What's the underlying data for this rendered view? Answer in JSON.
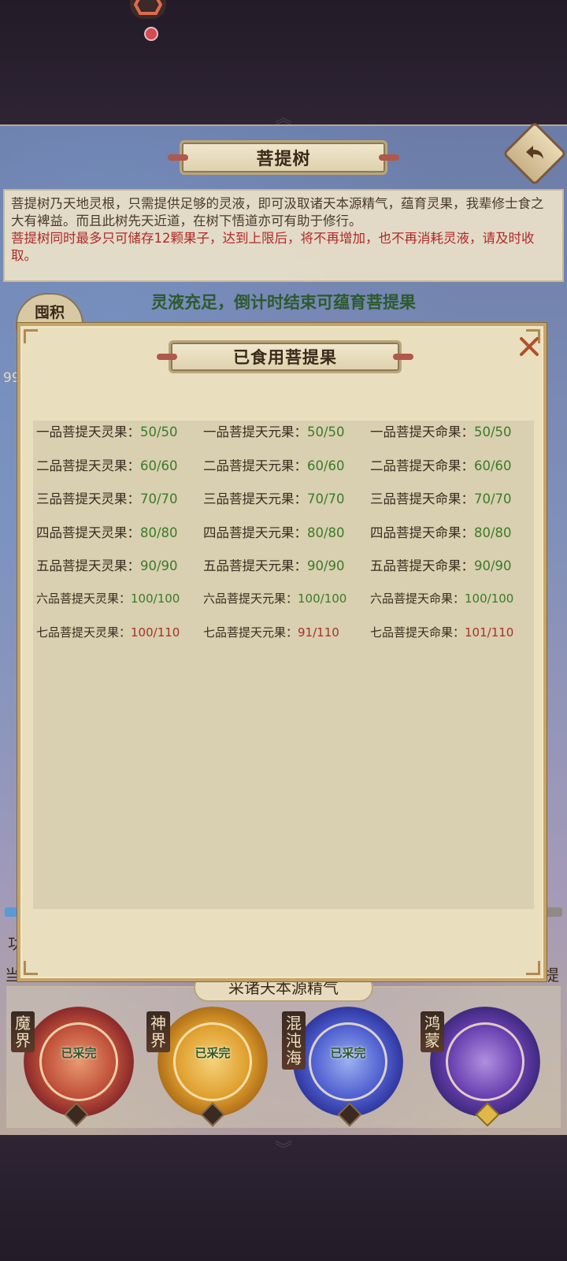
{
  "header": {
    "title": "菩提树"
  },
  "description": {
    "line1": "菩提树乃天地灵根，只需提供足够的灵液，即可汲取诸天本源精气，蕴育灵果，我辈修士食之大有裨益。而且此树先天近道，在树下悟道亦可有助于修行。",
    "line2": "菩提树同时最多只可储存12颗果子，达到上限后，将不再增加，也不再消耗灵液，请及时收取。"
  },
  "status": "灵液充足，倒计时结束可蕴育菩提果",
  "side": {
    "badge": "囤积",
    "number": "99",
    "left_text": "功",
    "left_text2": "当",
    "right_text": "提"
  },
  "collect_label": "采诸天本源精气",
  "orbs": [
    {
      "name": "魔界",
      "status": "已采完"
    },
    {
      "name": "神界",
      "status": "已采完"
    },
    {
      "name": "混沌海",
      "status": "已采完"
    },
    {
      "name": "鸿蒙",
      "status": ""
    }
  ],
  "modal": {
    "title": "已食用菩提果",
    "rows": [
      [
        {
          "label": "一品菩提天灵果：",
          "value": "50/50",
          "color": "green"
        },
        {
          "label": "一品菩提天元果：",
          "value": "50/50",
          "color": "green"
        },
        {
          "label": "一品菩提天命果：",
          "value": "50/50",
          "color": "green"
        }
      ],
      [
        {
          "label": "二品菩提天灵果：",
          "value": "60/60",
          "color": "green"
        },
        {
          "label": "二品菩提天元果：",
          "value": "60/60",
          "color": "green"
        },
        {
          "label": "二品菩提天命果：",
          "value": "60/60",
          "color": "green"
        }
      ],
      [
        {
          "label": "三品菩提天灵果：",
          "value": "70/70",
          "color": "green"
        },
        {
          "label": "三品菩提天元果：",
          "value": "70/70",
          "color": "green"
        },
        {
          "label": "三品菩提天命果：",
          "value": "70/70",
          "color": "green"
        }
      ],
      [
        {
          "label": "四品菩提天灵果：",
          "value": "80/80",
          "color": "green"
        },
        {
          "label": "四品菩提天元果：",
          "value": "80/80",
          "color": "green"
        },
        {
          "label": "四品菩提天命果：",
          "value": "80/80",
          "color": "green"
        }
      ],
      [
        {
          "label": "五品菩提天灵果：",
          "value": "90/90",
          "color": "green"
        },
        {
          "label": "五品菩提天元果：",
          "value": "90/90",
          "color": "green"
        },
        {
          "label": "五品菩提天命果：",
          "value": "90/90",
          "color": "green"
        }
      ],
      [
        {
          "label": "六品菩提天灵果：",
          "value": "100/100",
          "color": "green"
        },
        {
          "label": "六品菩提天元果：",
          "value": "100/100",
          "color": "green"
        },
        {
          "label": "六品菩提天命果：",
          "value": "100/100",
          "color": "green"
        }
      ],
      [
        {
          "label": "七品菩提天灵果：",
          "value": "100/110",
          "color": "red"
        },
        {
          "label": "七品菩提天元果：",
          "value": "91/110",
          "color": "red"
        },
        {
          "label": "七品菩提天命果：",
          "value": "101/110",
          "color": "red"
        }
      ]
    ]
  },
  "colors": {
    "complete": "#3c7a2a",
    "incomplete": "#a8302a",
    "accent": "#c5a468"
  }
}
